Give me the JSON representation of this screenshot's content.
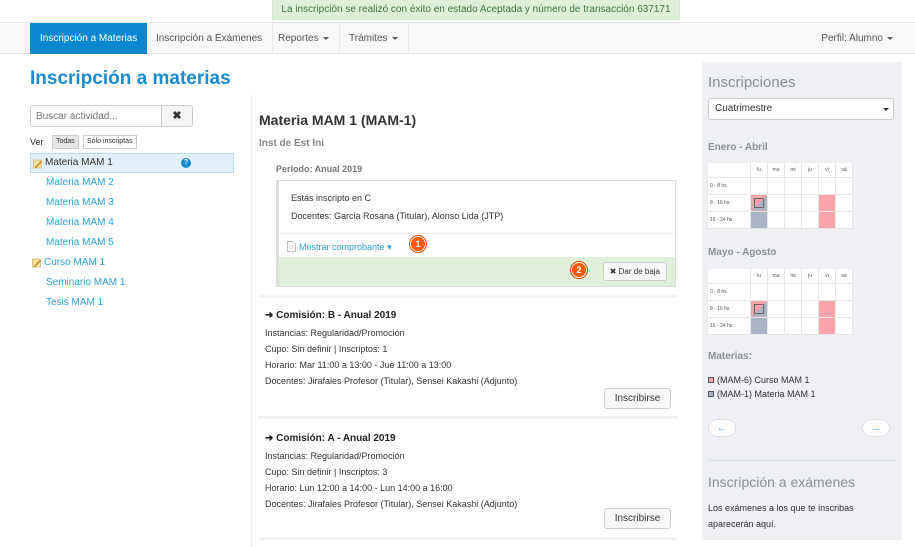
{
  "alert": {
    "text": "La inscripción se realizó con éxito en estado Aceptada y número de transacción 637171"
  },
  "navbar": {
    "tabs": [
      {
        "label": "Inscripción a Materias"
      },
      {
        "label": "Inscripción a Exámenes"
      },
      {
        "label": "Reportes"
      },
      {
        "label": "Trámites"
      }
    ],
    "perfil": "Perfil: Alumno"
  },
  "page": {
    "title": "Inscripción a materias"
  },
  "search": {
    "placeholder": "Buscar actividad...",
    "clear_icon": "✖"
  },
  "filter": {
    "label": "Ver",
    "options": [
      "Todas",
      "Sólo inscriptas"
    ],
    "selected": "Todas"
  },
  "activities": [
    {
      "label": "Materia MAM 1"
    },
    {
      "label": "Materia MAM 2"
    },
    {
      "label": "Materia MAM 3"
    },
    {
      "label": "Materia MAM 4"
    },
    {
      "label": "Materia MAM 5"
    },
    {
      "label": "Curso MAM 1"
    },
    {
      "label": "Seminario MAM 1"
    },
    {
      "label": "Tesis MAM 1"
    }
  ],
  "detail": {
    "title": "Materia MAM 1 (MAM-1)",
    "subtitle": "Inst de Est Ini",
    "periodo": "Periodo: Anual 2019",
    "inscripcion": {
      "line1": "Estás inscripto en C",
      "line2": "Docentes: Garcia Rosana (Titular), Alonso Lida (JTP)",
      "mostrar": "Mostrar comprobante",
      "mostrar_caret": "▾",
      "badge1": "1",
      "badge2": "2",
      "baja_icon": "✖",
      "baja_label": "Dar de baja"
    },
    "comisiones": [
      {
        "title": "➜ Comisión: B - Anual 2019",
        "instancias": "Instancias: Regularidad/Promoción",
        "cupo": "Cupo: Sin definir | Inscriptos: 1",
        "horario": "Horario: Mar 11:00 a 13:00 - Jue 11:00 a 13:00",
        "docentes": "Docentes: Jirafales Profesor (Titular), Sensei Kakashi (Adjunto)",
        "button": "Inscribirse"
      },
      {
        "title": "➜ Comisión: A - Anual 2019",
        "instancias": "Instancias: Regularidad/Promoción",
        "cupo": "Cupo: Sin definir | Inscriptos: 3",
        "horario": "Horario: Lun 12:00 a 14:00 - Lun 14:00 a 16:00",
        "docentes": "Docentes: Jirafales Profesor (Titular), Sensei Kakashi (Adjunto)",
        "button": "Inscribirse"
      }
    ]
  },
  "sidebar": {
    "title": "Inscripciones",
    "select_value": "Cuatrimestre",
    "periods": [
      {
        "label": "Enero - Abril"
      },
      {
        "label": "Mayo - Agosto"
      }
    ],
    "days": [
      "lu",
      "ma",
      "mi",
      "ju",
      "vi",
      "sá"
    ],
    "slots": [
      "0 - 8 hs",
      "8 - 16 hs",
      "16 - 24 hs"
    ],
    "materias_label": "Materias:",
    "legend": [
      {
        "label": "(MAM-6) Curso MAM 1",
        "color": "#f9a3ad"
      },
      {
        "label": "(MAM-1) Materia MAM 1",
        "color": "#aab4c7"
      }
    ],
    "prev": "←",
    "next": "→",
    "examenes_title": "Inscripción a exámenes",
    "examenes_text": "Los exámenes a los que te inscribas aparecerán aquí."
  }
}
